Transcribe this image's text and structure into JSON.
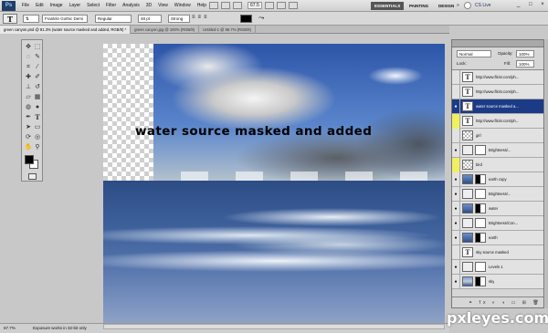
{
  "menubar": {
    "logo": "Ps",
    "items": [
      "File",
      "Edit",
      "Image",
      "Layer",
      "Select",
      "Filter",
      "Analysis",
      "3D",
      "View",
      "Window",
      "Help"
    ],
    "zoom": "67.5",
    "workspaces": [
      "ESSENTIALS",
      "PAINTING",
      "DESIGN"
    ],
    "more": "»",
    "cs_live": "CS Live",
    "window_controls": "_ □ ×"
  },
  "options": {
    "tool_icon": "T",
    "font_family": "Franklin Gothic Demi",
    "font_style": "Regular",
    "font_size": "48 pt",
    "antialias": "Strong",
    "text_color": "#000000"
  },
  "tabs": [
    "green canyon.psd @ 81.3% (water source masked and added, RGB/8) *",
    "green canyon.jpg @ 100% (RGB/8)",
    "Untitled-1 @ 66.7% (RGB/8)"
  ],
  "canvas": {
    "text": "water source masked and added"
  },
  "status": {
    "zoom": "67.7%",
    "message": "Exposure works in 32-bit only"
  },
  "layers": {
    "blend_mode": "Normal",
    "opacity_label": "Opacity:",
    "opacity": "100%",
    "lock_label": "Lock:",
    "fill_label": "Fill:",
    "fill": "100%",
    "rows": [
      {
        "name": "http://www.flickr.com/ph...",
        "thumb": "T",
        "kind": "text",
        "visible": false,
        "hl": false,
        "selected": false
      },
      {
        "name": "http://www.flickr.com/ph...",
        "thumb": "T",
        "kind": "text",
        "visible": false,
        "hl": false,
        "selected": false
      },
      {
        "name": "water source masked a...",
        "thumb": "T",
        "kind": "text",
        "visible": true,
        "hl": false,
        "selected": true
      },
      {
        "name": "http://www.flickr.com/ph...",
        "thumb": "T",
        "kind": "text",
        "visible": false,
        "hl": true,
        "selected": false
      },
      {
        "name": "girl",
        "thumb": "",
        "kind": "chk",
        "visible": false,
        "hl": false,
        "selected": false
      },
      {
        "name": "Brightness/...",
        "thumb": "",
        "kind": "adj",
        "visible": true,
        "hl": false,
        "selected": false
      },
      {
        "name": "bird",
        "thumb": "",
        "kind": "chk",
        "visible": false,
        "hl": true,
        "selected": false
      },
      {
        "name": "earth copy",
        "thumb": "",
        "kind": "img",
        "visible": true,
        "hl": false,
        "selected": false
      },
      {
        "name": "Brightness/...",
        "thumb": "",
        "kind": "adj",
        "visible": true,
        "hl": false,
        "selected": false
      },
      {
        "name": "water",
        "thumb": "",
        "kind": "img",
        "visible": true,
        "hl": false,
        "selected": false
      },
      {
        "name": "Brightness/Con...",
        "thumb": "",
        "kind": "adj",
        "visible": true,
        "hl": false,
        "selected": false
      },
      {
        "name": "earth",
        "thumb": "",
        "kind": "img",
        "visible": true,
        "hl": false,
        "selected": false
      },
      {
        "name": "sky source masked",
        "thumb": "T",
        "kind": "text",
        "visible": false,
        "hl": false,
        "selected": false
      },
      {
        "name": "Levels 1",
        "thumb": "",
        "kind": "adj",
        "visible": true,
        "hl": false,
        "selected": false
      },
      {
        "name": "sky",
        "thumb": "",
        "kind": "sky",
        "visible": true,
        "hl": false,
        "selected": false
      }
    ],
    "footer_icons": "⚭ fx ◐ ◑ ▭ ⊞ 🗑"
  },
  "watermark": "pxleyes.com"
}
